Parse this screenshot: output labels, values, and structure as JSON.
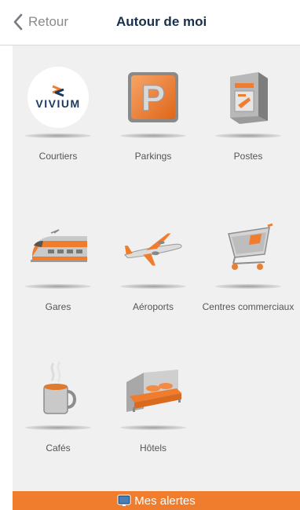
{
  "nav": {
    "back_label": "Retour",
    "title": "Autour de moi"
  },
  "tiles": [
    {
      "label": "Courtiers",
      "icon": "vivium-logo",
      "logo_text": "VIVIUM"
    },
    {
      "label": "Parkings",
      "icon": "parking-icon",
      "glyph": "P"
    },
    {
      "label": "Postes",
      "icon": "mailbox-icon"
    },
    {
      "label": "Gares",
      "icon": "train-icon"
    },
    {
      "label": "Aéroports",
      "icon": "airplane-icon"
    },
    {
      "label": "Centres commerciaux",
      "icon": "shopping-cart-icon"
    },
    {
      "label": "Cafés",
      "icon": "coffee-cup-icon"
    },
    {
      "label": "Hôtels",
      "icon": "hotel-bed-icon"
    }
  ],
  "footer": {
    "label": "Mes alertes",
    "icon": "alert-tablet-icon"
  },
  "colors": {
    "accent": "#f07d2e",
    "title": "#17304e",
    "background": "#f0f0f0"
  }
}
